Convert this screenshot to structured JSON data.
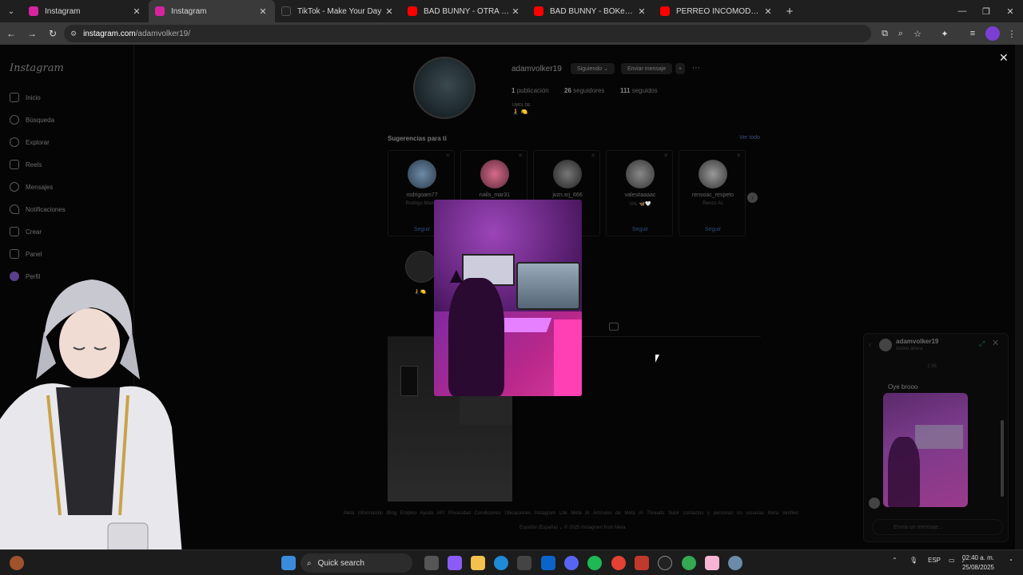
{
  "browser": {
    "tabs": [
      {
        "title": "Instagram",
        "icon": "instagram-icon",
        "color": "#d6249f",
        "active": false
      },
      {
        "title": "Instagram",
        "icon": "instagram-icon",
        "color": "#d6249f",
        "active": true
      },
      {
        "title": "TikTok - Make Your Day",
        "icon": "tiktok-icon",
        "color": "#222222",
        "active": false
      },
      {
        "title": "BAD BUNNY - OTRA NOCHE EN",
        "icon": "youtube-icon",
        "color": "#ff0000",
        "active": false
      },
      {
        "title": "BAD BUNNY - BOKeTE (Video C",
        "icon": "youtube-icon",
        "color": "#ff0000",
        "active": false
      },
      {
        "title": "PERREO INCÓMODO (Al Volan",
        "icon": "youtube-icon",
        "color": "#ff0000",
        "active": false
      }
    ],
    "url_host": "instagram.com",
    "url_path": "/adamvolker19/"
  },
  "sidebar": {
    "logo": "Instagram",
    "items": [
      {
        "label": "Inicio",
        "icon": "home-icon"
      },
      {
        "label": "Búsqueda",
        "icon": "search-icon"
      },
      {
        "label": "Explorar",
        "icon": "compass-icon"
      },
      {
        "label": "Reels",
        "icon": "reels-icon"
      },
      {
        "label": "Mensajes",
        "icon": "messenger-icon"
      },
      {
        "label": "Notificaciones",
        "icon": "heart-icon"
      },
      {
        "label": "Crear",
        "icon": "plus-icon"
      },
      {
        "label": "Panel",
        "icon": "dashboard-icon"
      },
      {
        "label": "Perfil",
        "icon": "profile-icon"
      }
    ]
  },
  "profile": {
    "username": "adamvolker19",
    "follow_button": "Siguiendo ⌄",
    "message_button": "Enviar mensaje",
    "posts_count": "1",
    "posts_label": "publicación",
    "followers_count": "26",
    "followers_label": "seguidores",
    "following_count": "111",
    "following_label": "seguidos",
    "bio_name": "UMOL DE",
    "bio_emoji": "🧎 🍋"
  },
  "suggestions": {
    "title": "Sugerencias para ti",
    "see_all": "Ver todo",
    "follow_label": "Seguir",
    "cards": [
      {
        "username": "rodrigoam77",
        "subtitle": "Rodrigo Marchi"
      },
      {
        "username": "nails_mar31",
        "subtitle": ""
      },
      {
        "username": "jvzn.xrj_666",
        "subtitle": ""
      },
      {
        "username": "valesitaaaac",
        "subtitle": "VAL 🦋🤍"
      },
      {
        "username": "rensoac_respeto",
        "subtitle": "Renzo Ac"
      }
    ]
  },
  "highlight": {
    "label": "🧎🍋"
  },
  "footer": {
    "links": "Meta  Información  Blog  Empleo  Ayuda  API  Privacidad  Condiciones  Ubicaciones  Instagram Lite  Meta AI  Artículos de Meta AI  Threads  Subir contactos y personas no usuarias  Meta Verified",
    "language": "Español (España) ⌄   © 2025 Instagram from Meta"
  },
  "chat": {
    "name": "adamvolker19",
    "status": "Activo ahora",
    "time": "1:36",
    "message": "Oye brooo",
    "input_placeholder": "Envía un mensaje..."
  },
  "taskbar": {
    "search_label": "Quick search",
    "language": "ESP",
    "time": "02:40 a. m.",
    "date": "25/08/2025"
  }
}
